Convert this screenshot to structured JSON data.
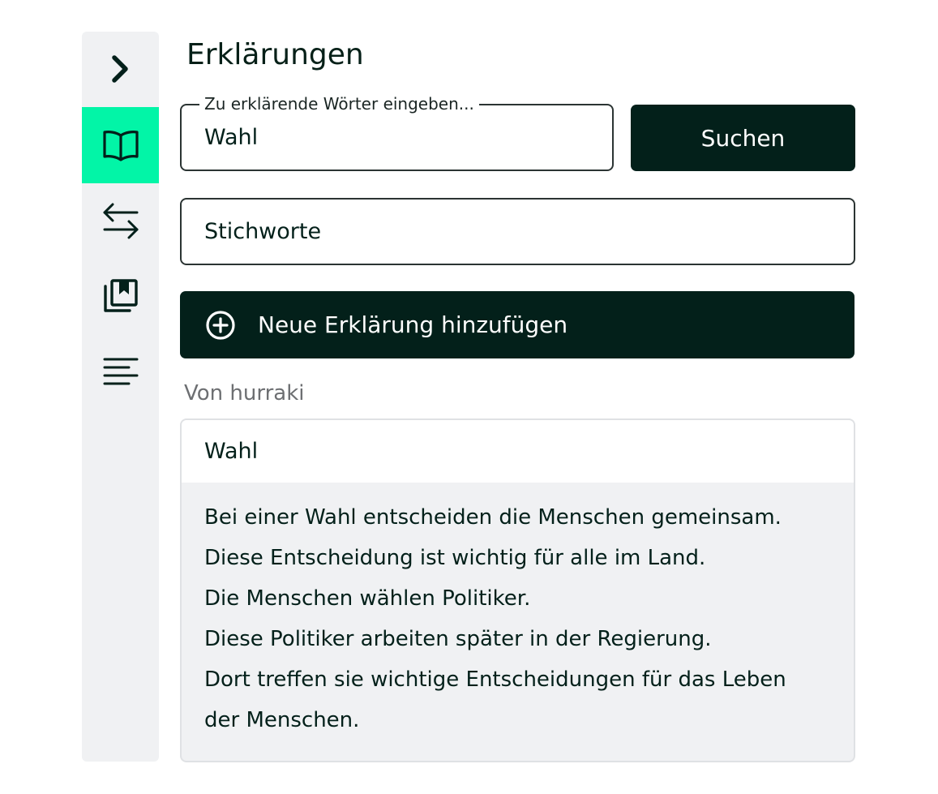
{
  "sidebar": {
    "items": [
      {
        "icon": "chevron-right-icon",
        "active": false
      },
      {
        "icon": "book-icon",
        "active": true
      },
      {
        "icon": "swap-arrows-icon",
        "active": false
      },
      {
        "icon": "bookmarks-icon",
        "active": false
      },
      {
        "icon": "text-lines-icon",
        "active": false
      }
    ],
    "active_color": "#02f5a7"
  },
  "main": {
    "title": "Erklärungen",
    "search": {
      "legend": "Zu erklärende Wörter eingeben...",
      "value": "Wahl",
      "button_label": "Suchen"
    },
    "tags": {
      "placeholder": "Stichworte"
    },
    "add_button_label": "Neue Erklärung hinzufügen",
    "source_label": "Von hurraki",
    "result": {
      "term": "Wahl",
      "lines": [
        "Bei einer Wahl entscheiden die Menschen gemeinsam.",
        "Diese Entscheidung ist wichtig für alle im Land.",
        "Die Menschen wählen Politiker.",
        "Diese Politiker arbeiten später in der Regierung.",
        "Dort treffen sie wichtige Entscheidungen für das Leben",
        "der Menschen."
      ]
    }
  },
  "colors": {
    "dark": "#03201a",
    "accent": "#02f5a7",
    "sidebar_bg": "#f0f1f3"
  }
}
